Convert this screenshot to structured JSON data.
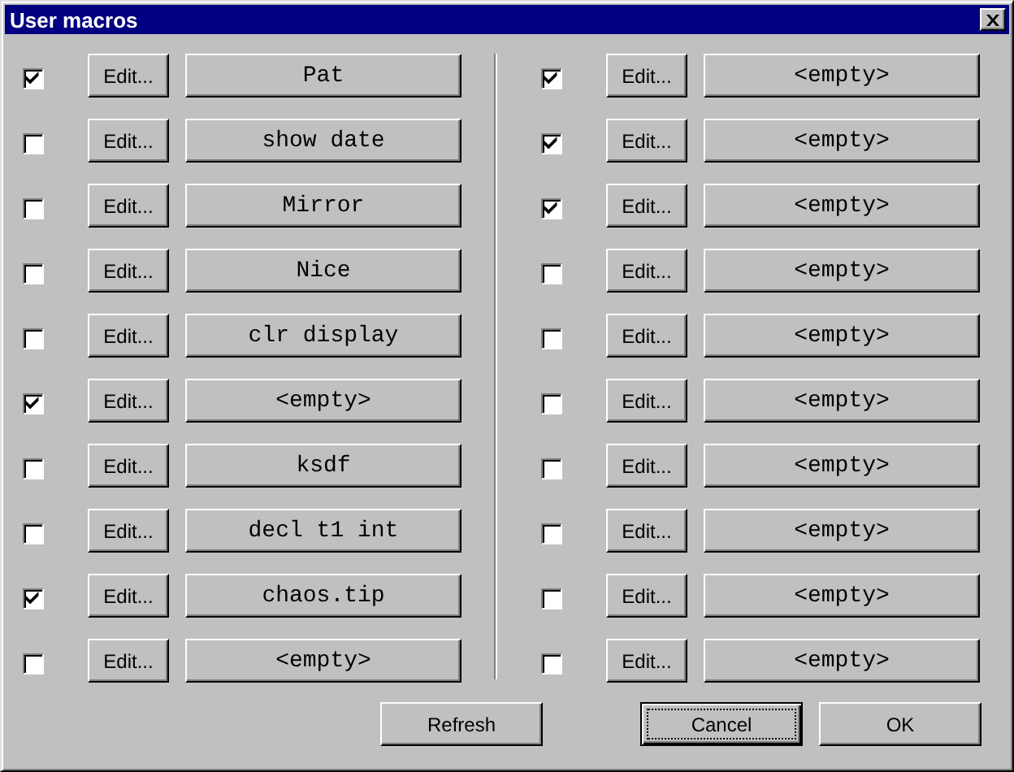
{
  "window": {
    "title": "User macros"
  },
  "columns": [
    {
      "rows": [
        {
          "checked": true,
          "edit": "Edit...",
          "macro": "Pat"
        },
        {
          "checked": false,
          "edit": "Edit...",
          "macro": "show date"
        },
        {
          "checked": false,
          "edit": "Edit...",
          "macro": "Mirror"
        },
        {
          "checked": false,
          "edit": "Edit...",
          "macro": "Nice"
        },
        {
          "checked": false,
          "edit": "Edit...",
          "macro": "clr display"
        },
        {
          "checked": true,
          "edit": "Edit...",
          "macro": "<empty>"
        },
        {
          "checked": false,
          "edit": "Edit...",
          "macro": "ksdf"
        },
        {
          "checked": false,
          "edit": "Edit...",
          "macro": "decl t1 int"
        },
        {
          "checked": true,
          "edit": "Edit...",
          "macro": "chaos.tip"
        },
        {
          "checked": false,
          "edit": "Edit...",
          "macro": "<empty>"
        }
      ]
    },
    {
      "rows": [
        {
          "checked": true,
          "edit": "Edit...",
          "macro": "<empty>"
        },
        {
          "checked": true,
          "edit": "Edit...",
          "macro": "<empty>"
        },
        {
          "checked": true,
          "edit": "Edit...",
          "macro": "<empty>"
        },
        {
          "checked": false,
          "edit": "Edit...",
          "macro": "<empty>"
        },
        {
          "checked": false,
          "edit": "Edit...",
          "macro": "<empty>"
        },
        {
          "checked": false,
          "edit": "Edit...",
          "macro": "<empty>"
        },
        {
          "checked": false,
          "edit": "Edit...",
          "macro": "<empty>"
        },
        {
          "checked": false,
          "edit": "Edit...",
          "macro": "<empty>"
        },
        {
          "checked": false,
          "edit": "Edit...",
          "macro": "<empty>"
        },
        {
          "checked": false,
          "edit": "Edit...",
          "macro": "<empty>"
        }
      ]
    }
  ],
  "buttons": [
    {
      "label": "Refresh",
      "focused": false
    },
    {
      "label": "Cancel",
      "focused": true
    },
    {
      "label": "OK",
      "focused": false
    }
  ]
}
